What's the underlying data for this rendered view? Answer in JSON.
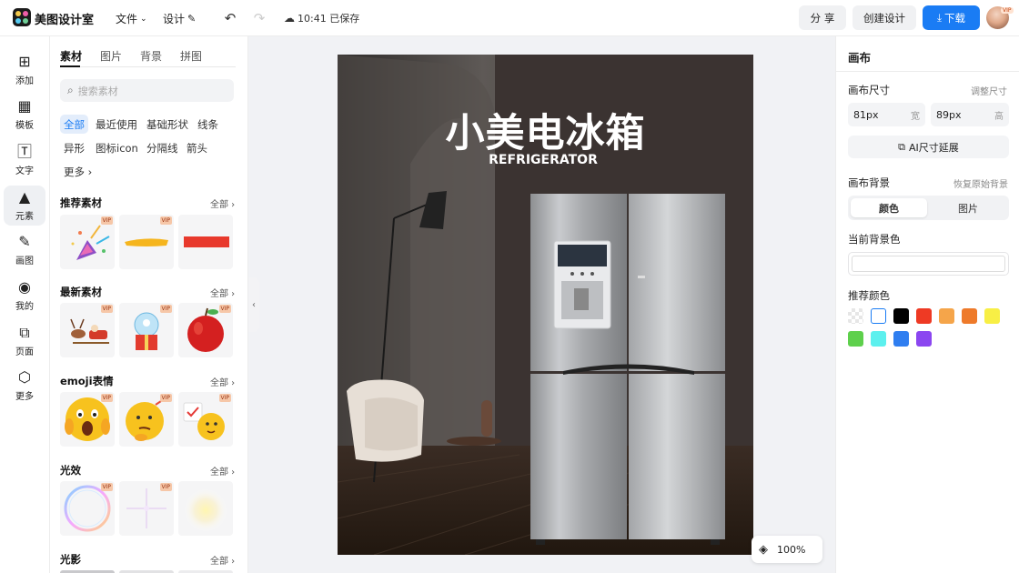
{
  "app": {
    "name": "美图设计室"
  },
  "topbar": {
    "file_menu": "文件",
    "design_menu": "设计",
    "save_status": "10:41 已保存",
    "share_label": "分 享",
    "create_label": "创建设计",
    "download_label": "下载",
    "avatar_badge": "VIP"
  },
  "leftnav": {
    "items": [
      {
        "label": "添加",
        "icon": "add-icon"
      },
      {
        "label": "模板",
        "icon": "template-icon"
      },
      {
        "label": "文字",
        "icon": "text-icon"
      },
      {
        "label": "元素",
        "icon": "element-icon"
      },
      {
        "label": "画图",
        "icon": "draw-icon"
      },
      {
        "label": "我的",
        "icon": "user-icon"
      },
      {
        "label": "页面",
        "icon": "page-icon"
      },
      {
        "label": "更多",
        "icon": "more-icon"
      }
    ]
  },
  "panel": {
    "tabs": [
      "素材",
      "图片",
      "背景",
      "拼图"
    ],
    "search_placeholder": "搜索素材",
    "chips": [
      "全部",
      "最近使用",
      "基础形状",
      "线条",
      "异形",
      "图标icon",
      "分隔线",
      "箭头",
      "更多"
    ],
    "sections": [
      {
        "title": "推荐素材",
        "all": "全部"
      },
      {
        "title": "最新素材",
        "all": "全部"
      },
      {
        "title": "emoji表情",
        "all": "全部"
      },
      {
        "title": "光效",
        "all": "全部"
      },
      {
        "title": "光影",
        "all": "全部"
      }
    ],
    "vip_label": "VIP"
  },
  "poster": {
    "title": "小美电冰箱",
    "subtitle": "REFRIGERATOR"
  },
  "zoom": {
    "level": "100%"
  },
  "right": {
    "title": "画布",
    "size_label": "画布尺寸",
    "adjust_size": "调整尺寸",
    "width_value": "81px",
    "width_unit": "宽",
    "height_value": "89px",
    "height_unit": "高",
    "ai_button": "AI尺寸延展",
    "bg_label": "画布背景",
    "restore_bg": "恢复原始背景",
    "seg_color": "颜色",
    "seg_image": "图片",
    "current_bg": "当前背景色",
    "recommend": "推荐颜色",
    "swatches": [
      "transparent",
      "#ffffff",
      "#000000",
      "#ee3a24",
      "#f5a54a",
      "#ee7a2a",
      "#f8ef45",
      "#5ed04c",
      "#5cf0ee",
      "#2f7ef0",
      "#8b46f0"
    ]
  }
}
